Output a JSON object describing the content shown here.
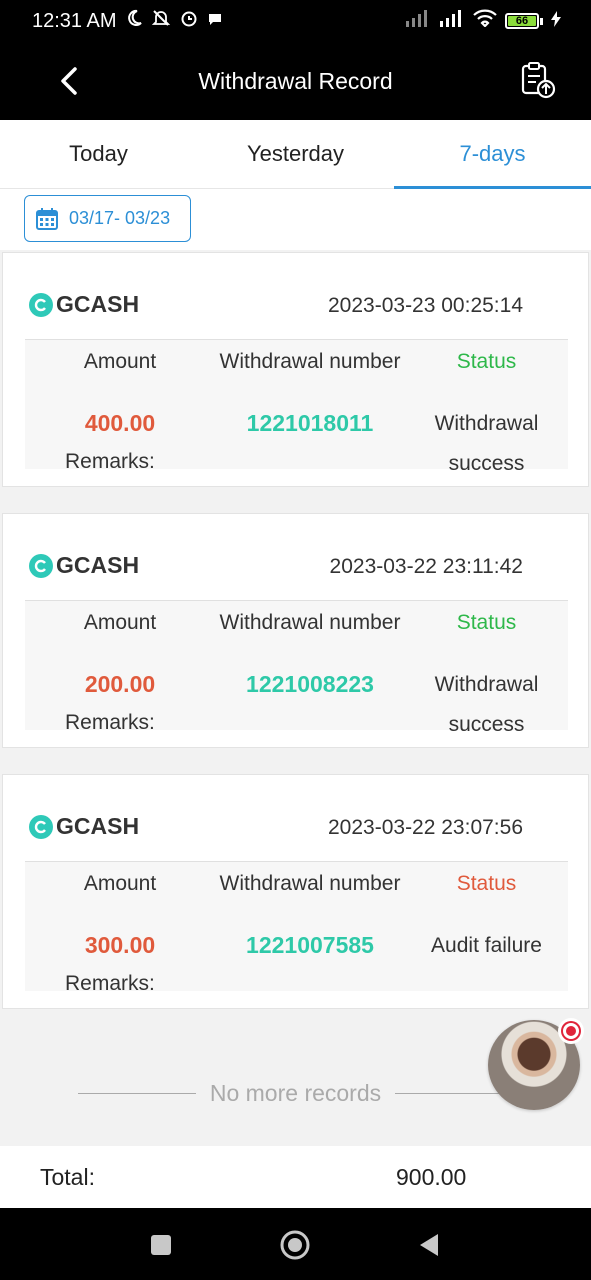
{
  "status_bar": {
    "time": "12:31 AM",
    "battery": "66"
  },
  "header": {
    "title": "Withdrawal Record"
  },
  "tabs": [
    {
      "label": "Today",
      "active": false
    },
    {
      "label": "Yesterday",
      "active": false
    },
    {
      "label": "7-days",
      "active": true
    }
  ],
  "date_range": "03/17- 03/23",
  "columns": {
    "amount": "Amount",
    "number": "Withdrawal number",
    "status": "Status",
    "remarks": "Remarks:"
  },
  "records": [
    {
      "method": "GCASH",
      "time": "2023-03-23 00:25:14",
      "amount": "400.00",
      "number": "1221018011",
      "status_line1": "Withdrawal",
      "status_line2": "success",
      "status_color": "#2eb84a"
    },
    {
      "method": "GCASH",
      "time": "2023-03-22 23:11:42",
      "amount": "200.00",
      "number": "1221008223",
      "status_line1": "Withdrawal",
      "status_line2": "success",
      "status_color": "#2eb84a"
    },
    {
      "method": "GCASH",
      "time": "2023-03-22 23:07:56",
      "amount": "300.00",
      "number": "1221007585",
      "status_line1": "Audit failure",
      "status_line2": "",
      "status_color": "#e05a3c"
    }
  ],
  "no_more": "No more records",
  "total": {
    "label": "Total:",
    "value": "900.00"
  },
  "colors": {
    "accent": "#2c8fd6",
    "amount": "#e05a3c",
    "number": "#2ec9a8"
  }
}
